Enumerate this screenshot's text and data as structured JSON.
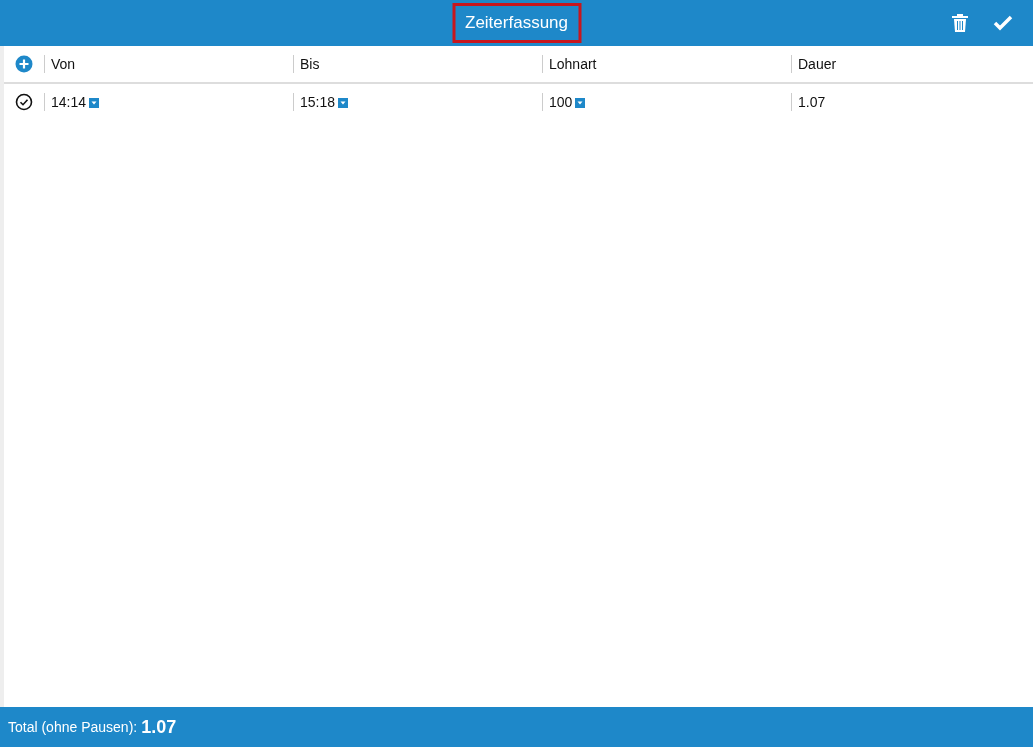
{
  "header": {
    "title": "Zeiterfassung",
    "title_highlighted": true
  },
  "table": {
    "columns": [
      "Von",
      "Bis",
      "Lohnart",
      "Dauer"
    ],
    "rows": [
      {
        "checked": true,
        "cells": [
          {
            "text": "14:14",
            "kind": "dropdown"
          },
          {
            "text": "15:18",
            "kind": "dropdown"
          },
          {
            "text": "100",
            "kind": "dropdown"
          },
          {
            "text": "1.07",
            "kind": "plain"
          }
        ]
      }
    ]
  },
  "footer": {
    "label": "Total (ohne Pausen):",
    "value": "1.07"
  }
}
